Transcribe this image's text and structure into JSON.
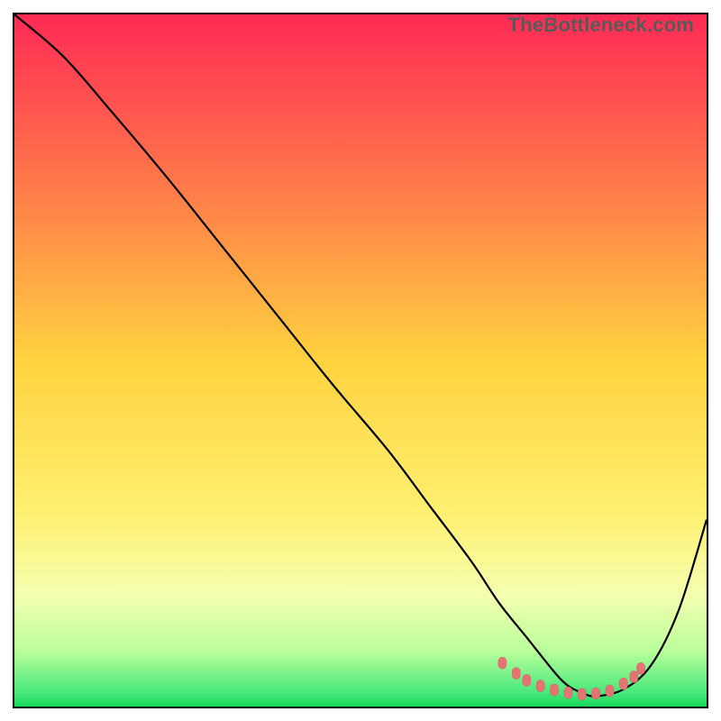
{
  "watermark": "TheBottleneck.com",
  "colors": {
    "frame": "#000000",
    "curve": "#000000",
    "dots": "#e57373",
    "dots_stroke": "#d46a6a"
  },
  "chart_data": {
    "type": "line",
    "title": "",
    "xlabel": "",
    "ylabel": "",
    "xlim": [
      0,
      100
    ],
    "ylim": [
      0,
      100
    ],
    "gradient_stops": [
      {
        "offset": 0,
        "color": "#ff2a55"
      },
      {
        "offset": 25,
        "color": "#ff7a4a"
      },
      {
        "offset": 50,
        "color": "#ffd23f"
      },
      {
        "offset": 72,
        "color": "#fff070"
      },
      {
        "offset": 84,
        "color": "#f4ffb0"
      },
      {
        "offset": 92,
        "color": "#b9ff9a"
      },
      {
        "offset": 98,
        "color": "#47e87a"
      },
      {
        "offset": 100,
        "color": "#16d858"
      }
    ],
    "series": [
      {
        "name": "bottleneck-curve",
        "x": [
          0,
          7,
          14,
          22,
          30,
          38,
          46,
          54,
          60,
          66,
          70,
          74,
          78,
          80,
          82,
          84,
          88,
          92,
          96,
          100
        ],
        "y": [
          100,
          94,
          86,
          76.5,
          66.5,
          56.5,
          46.5,
          37,
          29,
          21,
          15,
          10,
          5,
          3,
          2,
          1.5,
          2.5,
          6,
          14,
          27
        ]
      }
    ],
    "dots": {
      "name": "optimal-range-dots",
      "x": [
        70.5,
        72.5,
        74,
        76,
        78,
        80,
        82,
        84,
        86,
        88,
        89.5,
        90.5
      ],
      "y": [
        6.3,
        4.8,
        3.8,
        3.0,
        2.4,
        2.0,
        1.8,
        1.9,
        2.3,
        3.3,
        4.3,
        5.5
      ]
    }
  }
}
